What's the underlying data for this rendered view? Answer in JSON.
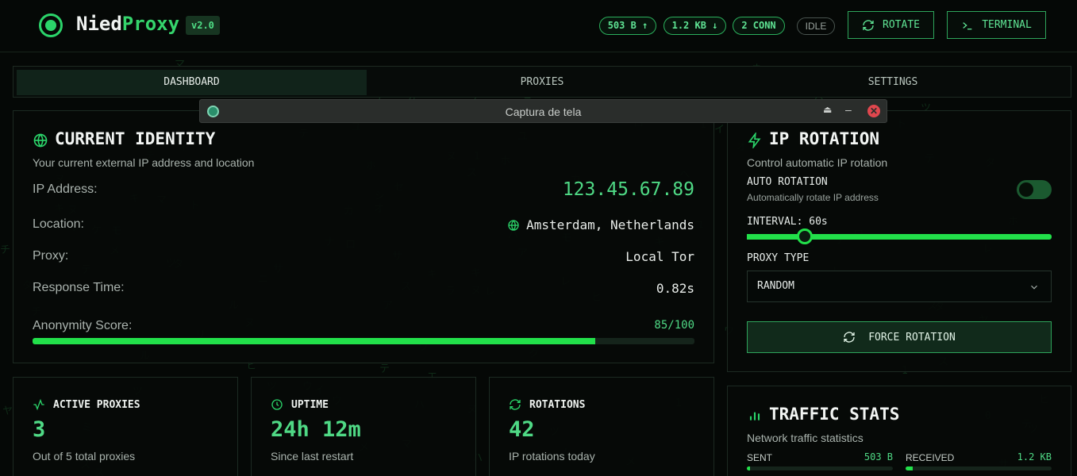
{
  "header": {
    "logo_part1": "Nied",
    "logo_part2": "Proxy",
    "version": "v2.0",
    "sent_pill": "503 B ↑",
    "recv_pill": "1.2 KB ↓",
    "conn_pill": "2 CONN",
    "status": "IDLE",
    "rotate_label": "ROTATE",
    "terminal_label": "TERMINAL"
  },
  "tabs": [
    {
      "label": "DASHBOARD",
      "active": true
    },
    {
      "label": "PROXIES",
      "active": false
    },
    {
      "label": "SETTINGS",
      "active": false
    }
  ],
  "overlay_window": {
    "title": "Captura de tela"
  },
  "identity": {
    "title": "CURRENT IDENTITY",
    "subtitle": "Your current external IP address and location",
    "ip_label": "IP Address:",
    "ip_value": "123.45.67.89",
    "location_label": "Location:",
    "location_value": "Amsterdam, Netherlands",
    "proxy_label": "Proxy:",
    "proxy_value": "Local Tor",
    "response_label": "Response Time:",
    "response_value": "0.82s",
    "anonymity_label": "Anonymity Score:",
    "anonymity_value": "85/100",
    "anonymity_fraction": 0.85
  },
  "rotation": {
    "title": "IP ROTATION",
    "subtitle": "Control automatic IP rotation",
    "auto_label": "AUTO ROTATION",
    "auto_desc": "Automatically rotate IP address",
    "auto_enabled": false,
    "interval_label": "INTERVAL: 60s",
    "interval_fraction": 0.19,
    "proxy_type_label": "PROXY TYPE",
    "proxy_type_value": "RANDOM",
    "force_label": "FORCE ROTATION"
  },
  "stats": [
    {
      "label": "ACTIVE PROXIES",
      "icon": "activity-icon",
      "value": "3",
      "desc": "Out of 5 total proxies"
    },
    {
      "label": "UPTIME",
      "icon": "clock-icon",
      "value": "24h 12m",
      "desc": "Since last restart"
    },
    {
      "label": "ROTATIONS",
      "icon": "refresh-icon",
      "value": "42",
      "desc": "IP rotations today"
    }
  ],
  "traffic": {
    "title": "TRAFFIC STATS",
    "subtitle": "Network traffic statistics",
    "sent_label": "SENT",
    "sent_value": "503 B",
    "sent_fraction": 0.02,
    "received_label": "RECEIVED",
    "received_value": "1.2 KB",
    "received_fraction": 0.05
  },
  "colors": {
    "accent": "#2bd46a",
    "progress": "#22e04a",
    "background": "#050806"
  }
}
